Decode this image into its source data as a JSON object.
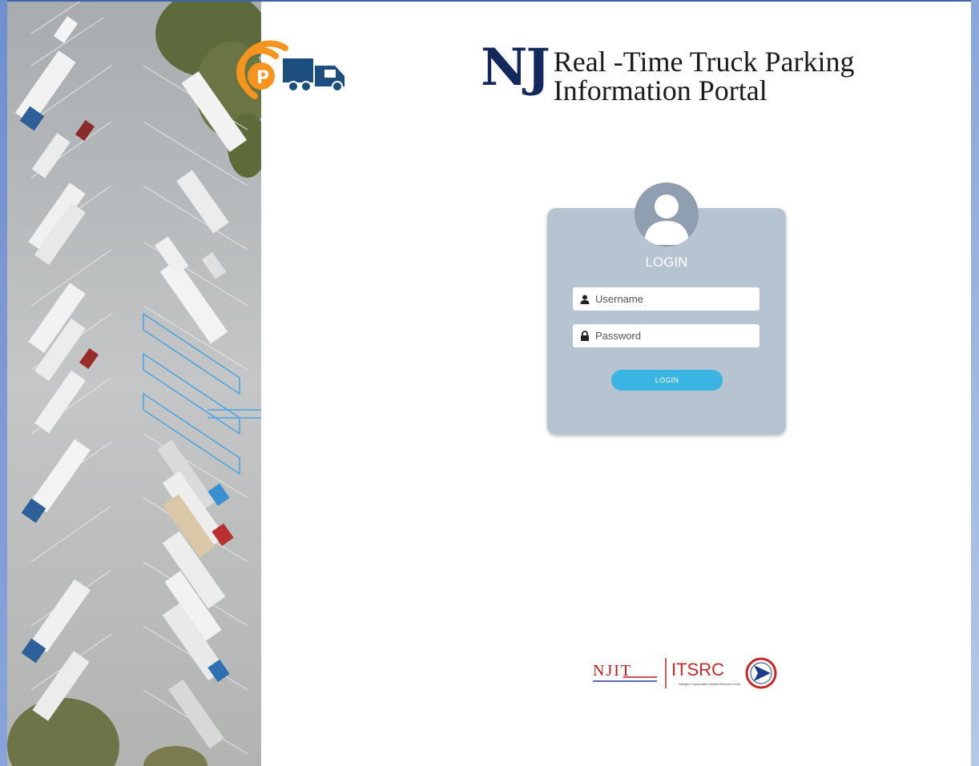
{
  "header": {
    "title_abbr": "NJ",
    "title_line1": "Real -Time Truck Parking",
    "title_line2": "Information Portal"
  },
  "login": {
    "heading": "LOGIN",
    "username_placeholder": "Username",
    "password_placeholder": "Password",
    "submit_label": "LOGIN"
  },
  "footer": {
    "njit_logo": "NJIT",
    "itsrc_logo": "ITSRC",
    "itsrc_subtitle": "Intelligent Transportation Systems Resource Center"
  },
  "colors": {
    "brand_navy": "#13295e",
    "card_bg": "#b6c3d0",
    "button_blue": "#3ab4e2",
    "logo_orange": "#f7941d"
  },
  "icons": [
    "parking-logo-icon",
    "truck-icon",
    "avatar-icon",
    "user-icon",
    "lock-icon",
    "njdot-logo-icon"
  ]
}
